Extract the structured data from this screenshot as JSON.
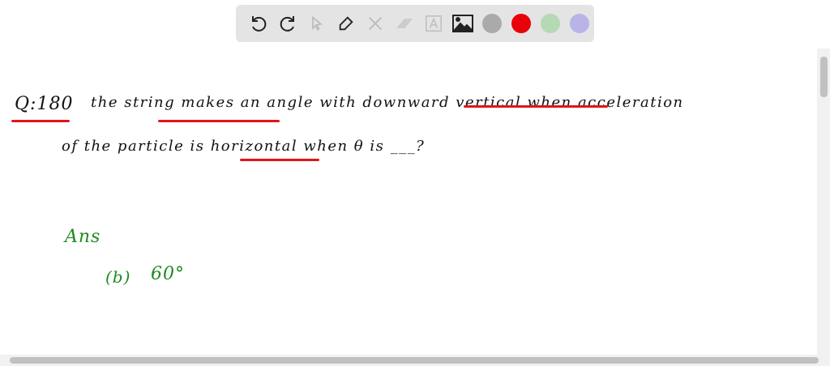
{
  "toolbar": {
    "tools": [
      "undo-icon",
      "redo-icon",
      "pointer-icon",
      "pen-icon",
      "tools-icon",
      "eraser-icon",
      "text-icon",
      "image-icon"
    ],
    "colors": [
      "#aaaaaa",
      "#e8000b",
      "#b5d9b5",
      "#b8b4e8"
    ]
  },
  "content": {
    "question_number": "Q:180",
    "line1": "the string makes an angle with downward vertical when acceleration",
    "line2": "of the particle is horizontal when θ is ___?",
    "answer_label": "Ans",
    "answer_option": "(b)",
    "answer_value": "60°"
  }
}
